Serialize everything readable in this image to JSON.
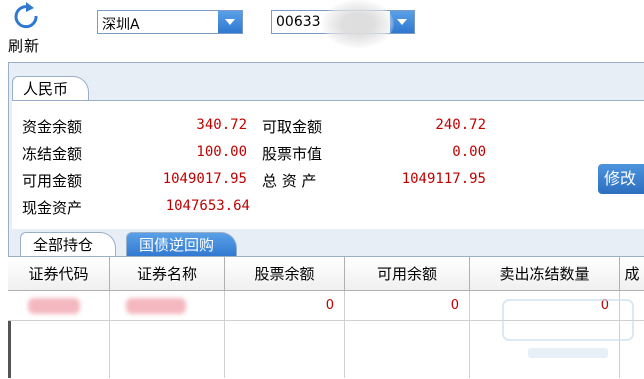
{
  "toolbar": {
    "refresh_label": "刷新",
    "market_select_value": "深圳A",
    "account_select_value": "00633"
  },
  "panel": {
    "tab_label": "人民币",
    "fields": {
      "cash_balance_label": "资金余额",
      "cash_balance_value": "340.72",
      "withdrawable_label": "可取金额",
      "withdrawable_value": "240.72",
      "frozen_label": "冻结金额",
      "frozen_value": "100.00",
      "stock_value_label": "股票市值",
      "stock_value_value": "0.00",
      "available_label": "可用金额",
      "available_value": "1049017.95",
      "total_assets_label": "总 资 产",
      "total_assets_value": "1049117.95",
      "cash_assets_label": "现金资产",
      "cash_assets_value": "1047653.64"
    },
    "modify_button_label": "修改"
  },
  "tabs": [
    {
      "label": "全部持仓",
      "active": false
    },
    {
      "label": "国债逆回购",
      "active": true
    }
  ],
  "table": {
    "columns": [
      "证券代码",
      "证券名称",
      "股票余额",
      "可用余额",
      "卖出冻结数量",
      "成"
    ],
    "rows": [
      {
        "code": "",
        "name": "",
        "stock_balance": "0",
        "available_balance": "0",
        "sell_frozen": "0"
      }
    ]
  },
  "colors": {
    "accent": "#2f78d0",
    "value_red": "#c00000"
  }
}
